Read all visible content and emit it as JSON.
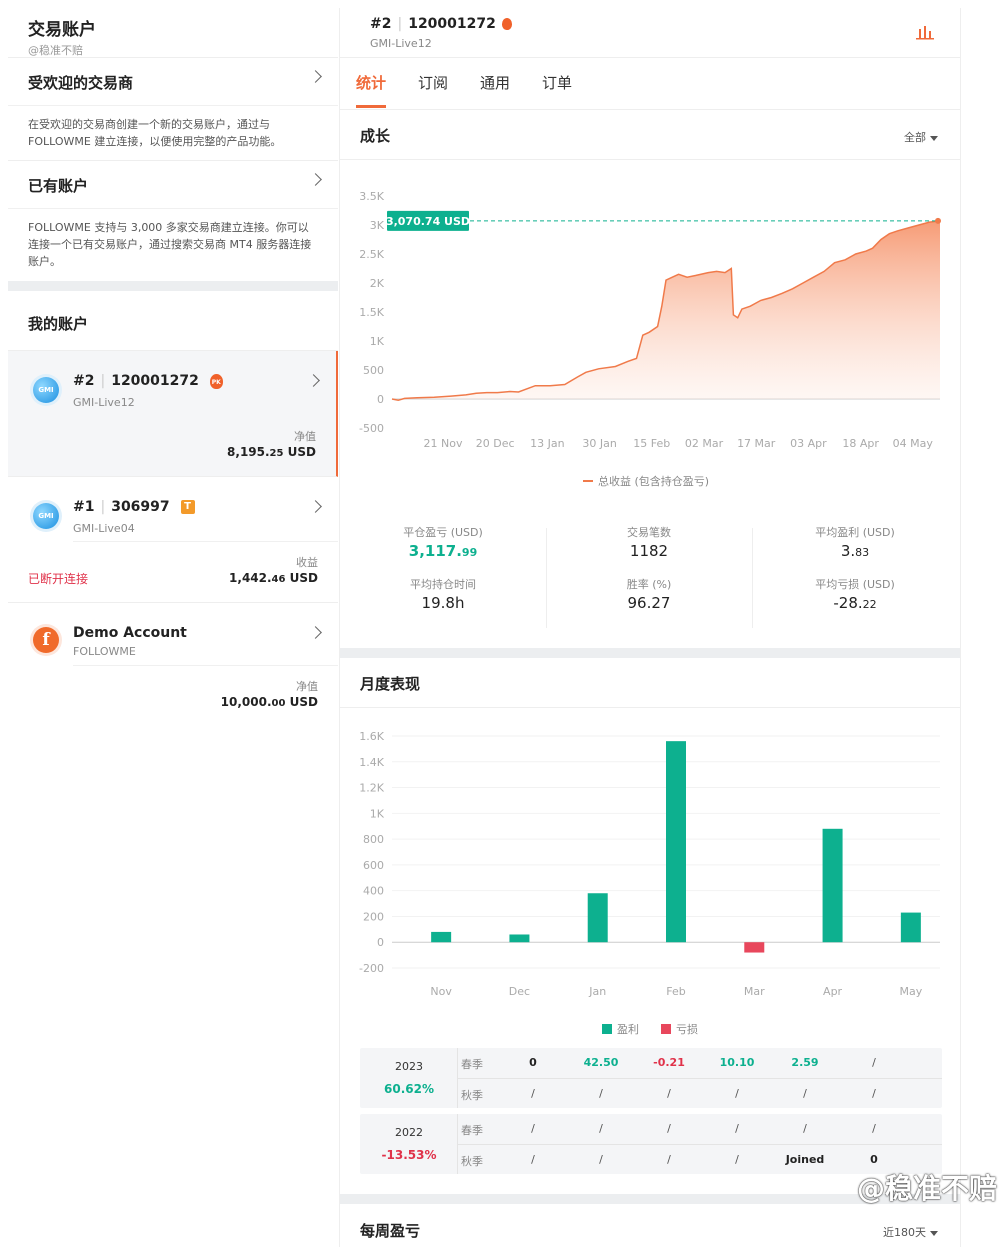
{
  "left": {
    "title": "交易账户",
    "subtitle": "@稳准不赔",
    "popular": {
      "title": "受欢迎的交易商",
      "desc": "在受欢迎的交易商创建一个新的交易账户，通过与 FOLLOWME 建立连接，以便使用完整的产品功能。"
    },
    "existing": {
      "title": "已有账户",
      "desc": "FOLLOWME 支持与 3,000 多家交易商建立连接。你可以连接一个已有交易账户，通过搜索交易商 MT4 服务器连接账户。"
    },
    "my_accounts_title": "我的账户",
    "accounts": [
      {
        "index": "#2",
        "number": "120001272",
        "server": "GMI-Live12",
        "badge": "PK",
        "label": "净值",
        "value_main": "8,195.",
        "value_dec": "25",
        "value_unit": " USD",
        "logo": "GMI"
      },
      {
        "index": "#1",
        "number": "306997",
        "server": "GMI-Live04",
        "badge": "T",
        "label": "收益",
        "value_main": "1,442.",
        "value_dec": "46",
        "value_unit": " USD",
        "status": "已断开连接",
        "logo": "GMI"
      },
      {
        "name": "Demo Account",
        "server": "FOLLOWME",
        "label": "净值",
        "value_main": "10,000.",
        "value_dec": "00",
        "value_unit": " USD",
        "logo": "f"
      }
    ]
  },
  "header": {
    "index": "#2",
    "number": "120001272",
    "server": "GMI-Live12"
  },
  "tabs": [
    "统计",
    "订阅",
    "通用",
    "订单"
  ],
  "growth": {
    "title": "成长",
    "filter": "全部",
    "current_label": "3,070.74 USD",
    "legend": "总收益 (包含持仓盈亏)",
    "colors": {
      "line": "#f07a4a",
      "area_top": "#f58a5e",
      "dash": "#0db08f",
      "tag": "#0db08f"
    }
  },
  "stats": [
    {
      "label": "平仓盈亏 (USD)",
      "main": "3,117.",
      "dec": "99",
      "green": true
    },
    {
      "label": "交易笔数",
      "main": "1182",
      "dec": ""
    },
    {
      "label": "平均盈利 (USD)",
      "main": "3.",
      "dec": "83"
    },
    {
      "label": "平均持仓时间",
      "main": "19.8h",
      "dec": ""
    },
    {
      "label": "胜率 (%)",
      "main": "96.27",
      "dec": ""
    },
    {
      "label": "平均亏损 (USD)",
      "main": "-28.",
      "dec": "22"
    }
  ],
  "monthly": {
    "title": "月度表现",
    "legend_profit": "盈利",
    "legend_loss": "亏损",
    "colors": {
      "profit": "#0db08f",
      "loss": "#e8475c"
    }
  },
  "perf_table": [
    {
      "year": "2023",
      "pct": "60.62%",
      "pct_color": "#0db08f",
      "rows": [
        {
          "season": "春季",
          "cells": [
            {
              "v": "0",
              "c": "k"
            },
            {
              "v": "42.50",
              "c": "g"
            },
            {
              "v": "-0.21",
              "c": "r"
            },
            {
              "v": "10.10",
              "c": "g"
            },
            {
              "v": "2.59",
              "c": "g"
            },
            {
              "v": "/",
              "c": ""
            }
          ]
        },
        {
          "season": "秋季",
          "cells": [
            {
              "v": "/",
              "c": ""
            },
            {
              "v": "/",
              "c": ""
            },
            {
              "v": "/",
              "c": ""
            },
            {
              "v": "/",
              "c": ""
            },
            {
              "v": "/",
              "c": ""
            },
            {
              "v": "/",
              "c": ""
            }
          ]
        }
      ]
    },
    {
      "year": "2022",
      "pct": "-13.53%",
      "pct_color": "#e0324a",
      "rows": [
        {
          "season": "春季",
          "cells": [
            {
              "v": "/",
              "c": ""
            },
            {
              "v": "/",
              "c": ""
            },
            {
              "v": "/",
              "c": ""
            },
            {
              "v": "/",
              "c": ""
            },
            {
              "v": "/",
              "c": ""
            },
            {
              "v": "/",
              "c": ""
            }
          ]
        },
        {
          "season": "秋季",
          "cells": [
            {
              "v": "/",
              "c": ""
            },
            {
              "v": "/",
              "c": ""
            },
            {
              "v": "/",
              "c": ""
            },
            {
              "v": "/",
              "c": ""
            },
            {
              "v": "Joined",
              "c": "k"
            },
            {
              "v": "0",
              "c": "k"
            }
          ]
        }
      ]
    }
  ],
  "weekly": {
    "title": "每周盈亏",
    "filter": "近180天"
  },
  "watermark": "@稳准不赔",
  "chart_data": [
    {
      "type": "area",
      "y_ticks": [
        "3.5K",
        "3K",
        "2.5K",
        "2K",
        "1.5K",
        "1K",
        "500",
        "0",
        "-500"
      ],
      "x_ticks": [
        "21 Nov",
        "20 Dec",
        "13 Jan",
        "30 Jan",
        "15 Feb",
        "02 Mar",
        "17 Mar",
        "03 Apr",
        "18 Apr",
        "04 May"
      ],
      "ylim": [
        -500,
        3500
      ],
      "series": [
        {
          "name": "总收益 (包含持仓盈亏)",
          "points": [
            [
              0,
              0
            ],
            [
              3,
              -20
            ],
            [
              6,
              10
            ],
            [
              12,
              20
            ],
            [
              20,
              30
            ],
            [
              28,
              50
            ],
            [
              35,
              70
            ],
            [
              40,
              100
            ],
            [
              45,
              110
            ],
            [
              50,
              110
            ],
            [
              56,
              130
            ],
            [
              60,
              120
            ],
            [
              68,
              230
            ],
            [
              75,
              230
            ],
            [
              82,
              250
            ],
            [
              88,
              380
            ],
            [
              92,
              460
            ],
            [
              98,
              520
            ],
            [
              106,
              560
            ],
            [
              112,
              650
            ],
            [
              116,
              700
            ],
            [
              119,
              1100
            ],
            [
              122,
              1150
            ],
            [
              126,
              1250
            ],
            [
              128,
              1600
            ],
            [
              130,
              2050
            ],
            [
              133,
              2100
            ],
            [
              136,
              2150
            ],
            [
              140,
              2100
            ],
            [
              144,
              2130
            ],
            [
              150,
              2180
            ],
            [
              154,
              2200
            ],
            [
              158,
              2180
            ],
            [
              161,
              2250
            ],
            [
              162,
              1450
            ],
            [
              164,
              1400
            ],
            [
              166,
              1550
            ],
            [
              170,
              1600
            ],
            [
              175,
              1700
            ],
            [
              180,
              1750
            ],
            [
              185,
              1820
            ],
            [
              190,
              1900
            ],
            [
              195,
              2000
            ],
            [
              200,
              2100
            ],
            [
              205,
              2200
            ],
            [
              210,
              2350
            ],
            [
              215,
              2400
            ],
            [
              220,
              2500
            ],
            [
              225,
              2550
            ],
            [
              228,
              2600
            ],
            [
              232,
              2750
            ],
            [
              236,
              2850
            ],
            [
              240,
              2900
            ],
            [
              245,
              2950
            ],
            [
              250,
              3000
            ],
            [
              255,
              3050
            ],
            [
              260,
              3070.74
            ]
          ]
        }
      ]
    },
    {
      "type": "bar",
      "categories": [
        "Nov",
        "Dec",
        "Jan",
        "Feb",
        "Mar",
        "Apr",
        "May"
      ],
      "values": [
        80,
        60,
        380,
        1560,
        -80,
        880,
        230
      ],
      "y_ticks": [
        "1.6K",
        "1.4K",
        "1.2K",
        "1K",
        "800",
        "600",
        "400",
        "200",
        "0",
        "-200"
      ],
      "ylim": [
        -200,
        1600
      ],
      "series": [
        {
          "name": "盈利"
        },
        {
          "name": "亏损"
        }
      ]
    }
  ]
}
